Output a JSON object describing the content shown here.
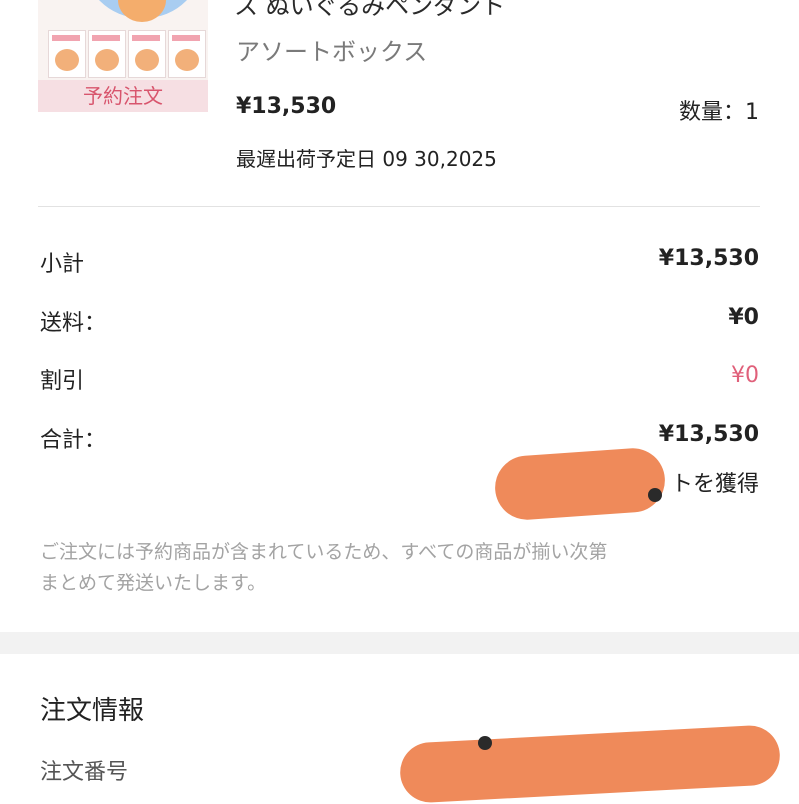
{
  "product": {
    "title": "ス ぬいぐるみペンダント",
    "variant": "アソートボックス",
    "preorder_tag": "予約注文",
    "price": "¥13,530",
    "quantity_label": "数量：1",
    "ship_date": "最遅出荷予定日 09 30,2025"
  },
  "summary": {
    "subtotal_label": "小計",
    "subtotal_value": "¥13,530",
    "shipping_label": "送料：",
    "shipping_value": "¥0",
    "discount_label": "割引",
    "discount_value": "¥0",
    "total_label": "合計：",
    "total_value": "¥13,530",
    "points_text": "トを獲得"
  },
  "note": {
    "line1": "ご注文には予約商品が含まれているため、すべての商品が揃い次第",
    "line2": "まとめて発送いたします。"
  },
  "order_info": {
    "section_title": "注文情報",
    "order_number_label": "注文番号"
  },
  "colors": {
    "discount": "#e0607a",
    "preorder_tag_text": "#d8556d",
    "preorder_tag_bg": "#f6dfe3",
    "redaction": "#ef8a5a"
  }
}
